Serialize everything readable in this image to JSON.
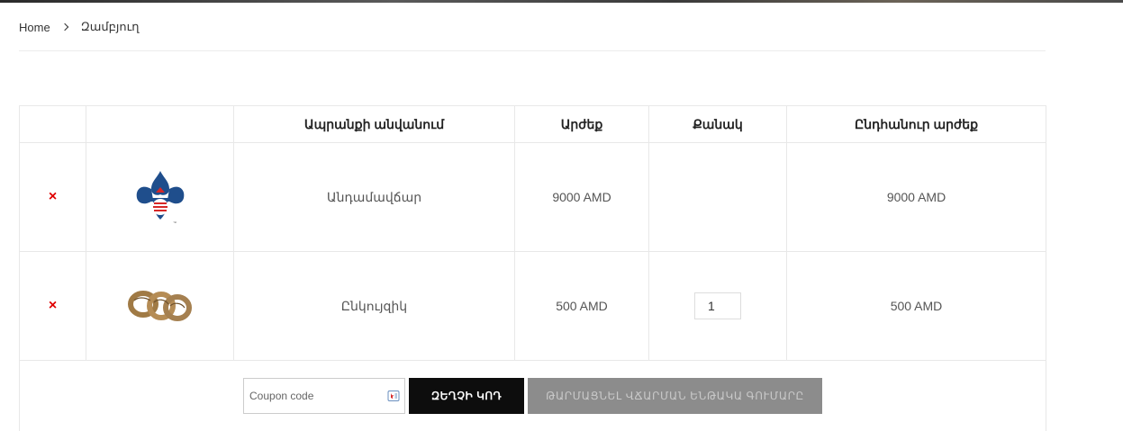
{
  "breadcrumb": {
    "home": "Home",
    "current": "Զամբյուղ"
  },
  "table": {
    "headers": [
      "",
      "",
      "Ապրանքի անվանում",
      "Արժեք",
      "Քանակ",
      "Ընդհանուր արժեք"
    ],
    "rows": [
      {
        "name": "Անդամավճար",
        "price": "9000 AMD",
        "quantity": "",
        "total": "9000 AMD",
        "image_icon": "scout-emblem-icon"
      },
      {
        "name": "Ընկույզիկ",
        "price": "500 AMD",
        "quantity": "1",
        "total": "500 AMD",
        "image_icon": "woggle-rings-icon"
      }
    ],
    "remove_glyph": "×"
  },
  "coupon": {
    "placeholder": "Coupon code",
    "apply_label": "ԶԵՂՉԻ ԿՈԴ",
    "update_label": "ԹԱՐՄԱՑՆԵԼ ՎՃԱՐՄԱՆ ԵՆԹԱԿԱ ԳՈՒՄԱՐԸ"
  },
  "colors": {
    "remove": "#e00000",
    "apply_bg": "#0d0d0d",
    "update_bg": "#8c8c8c"
  }
}
